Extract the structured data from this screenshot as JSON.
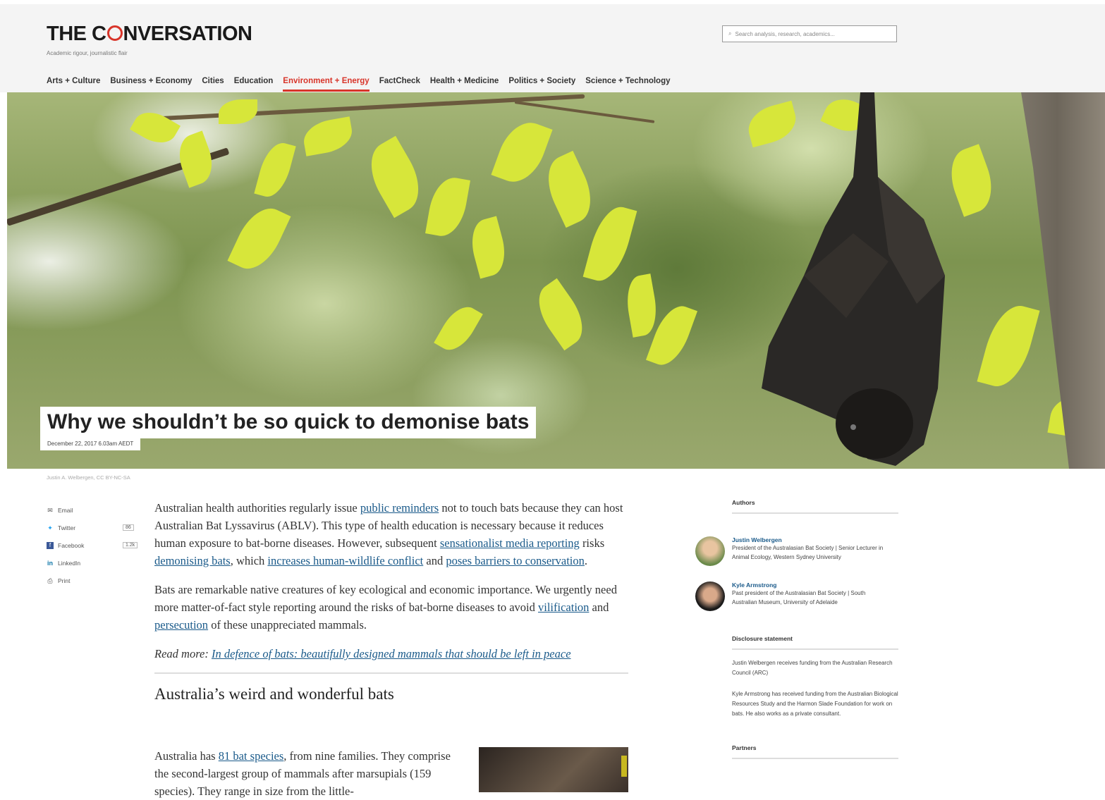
{
  "header": {
    "logo_before": "THE C",
    "logo_after": "NVERSATION",
    "tagline": "Academic rigour, journalistic flair",
    "search_placeholder": "Search analysis, research, academics..."
  },
  "nav": [
    {
      "label": "Arts + Culture",
      "active": false
    },
    {
      "label": "Business + Economy",
      "active": false
    },
    {
      "label": "Cities",
      "active": false
    },
    {
      "label": "Education",
      "active": false
    },
    {
      "label": "Environment + Energy",
      "active": true
    },
    {
      "label": "FactCheck",
      "active": false
    },
    {
      "label": "Health + Medicine",
      "active": false
    },
    {
      "label": "Politics + Society",
      "active": false
    },
    {
      "label": "Science + Technology",
      "active": false
    }
  ],
  "hero": {
    "title": "Why we shouldn’t be so quick to demonise bats",
    "date": "December 22, 2017 6.03am AEDT",
    "credit": "Justin A. Welbergen, CC BY-NC-SA"
  },
  "share": {
    "email": "Email",
    "twitter": "Twitter",
    "twitter_count": "86",
    "facebook": "Facebook",
    "facebook_count": "1.2k",
    "linkedin": "LinkedIn",
    "print": "Print"
  },
  "article": {
    "p1": {
      "t1": "Australian health authorities regularly issue ",
      "l1": "public reminders",
      "t2": " not to touch bats because they can host Australian Bat Lyssavirus (ABLV). This type of health education is necessary because it reduces human exposure to bat-borne diseases. However, subsequent ",
      "l2": "sensationalist media reporting",
      "t3": " risks ",
      "l3": "demonising bats",
      "t4": ", which ",
      "l4": "increases human-wildlife conflict",
      "t5": " and ",
      "l5": "poses barriers to conservation",
      "t6": "."
    },
    "p2": {
      "t1": "Bats are remarkable native creatures of key ecological and economic importance. We urgently need more matter-of-fact style reporting around the risks of bat-borne diseases to avoid ",
      "l1": "vilification",
      "t2": " and ",
      "l2": "persecution",
      "t3": " of these unappreciated mammals."
    },
    "readmore_prefix": "Read more: ",
    "readmore_link": "In defence of bats: beautifully designed mammals that should be left in peace",
    "subhead": "Australia’s weird and wonderful bats",
    "p3": {
      "t1": "Australia has ",
      "l1": "81 bat species",
      "t2": ", from nine families. They comprise the second-largest group of mammals after marsupials (159 species). They range in size from the little-"
    }
  },
  "sidebar": {
    "authors_heading": "Authors",
    "authors": [
      {
        "name": "Justin Welbergen",
        "role": "President of the Australasian Bat Society | Senior Lecturer in Animal Ecology, Western Sydney University"
      },
      {
        "name": "Kyle Armstrong",
        "role": "Past president of the Australasian Bat Society | South Australian Museum, University of Adelaide"
      }
    ],
    "disclosure_heading": "Disclosure statement",
    "disclosure_1": "Justin Welbergen receives funding from the Australian Research Council (ARC)",
    "disclosure_2": "Kyle Armstrong has received funding from the Australian Biological Resources Study and the Harmon Slade Foundation for work on bats. He also works as a private consultant.",
    "partners_heading": "Partners"
  },
  "colors": {
    "accent": "#d8352a",
    "link": "#1a5a8a"
  }
}
